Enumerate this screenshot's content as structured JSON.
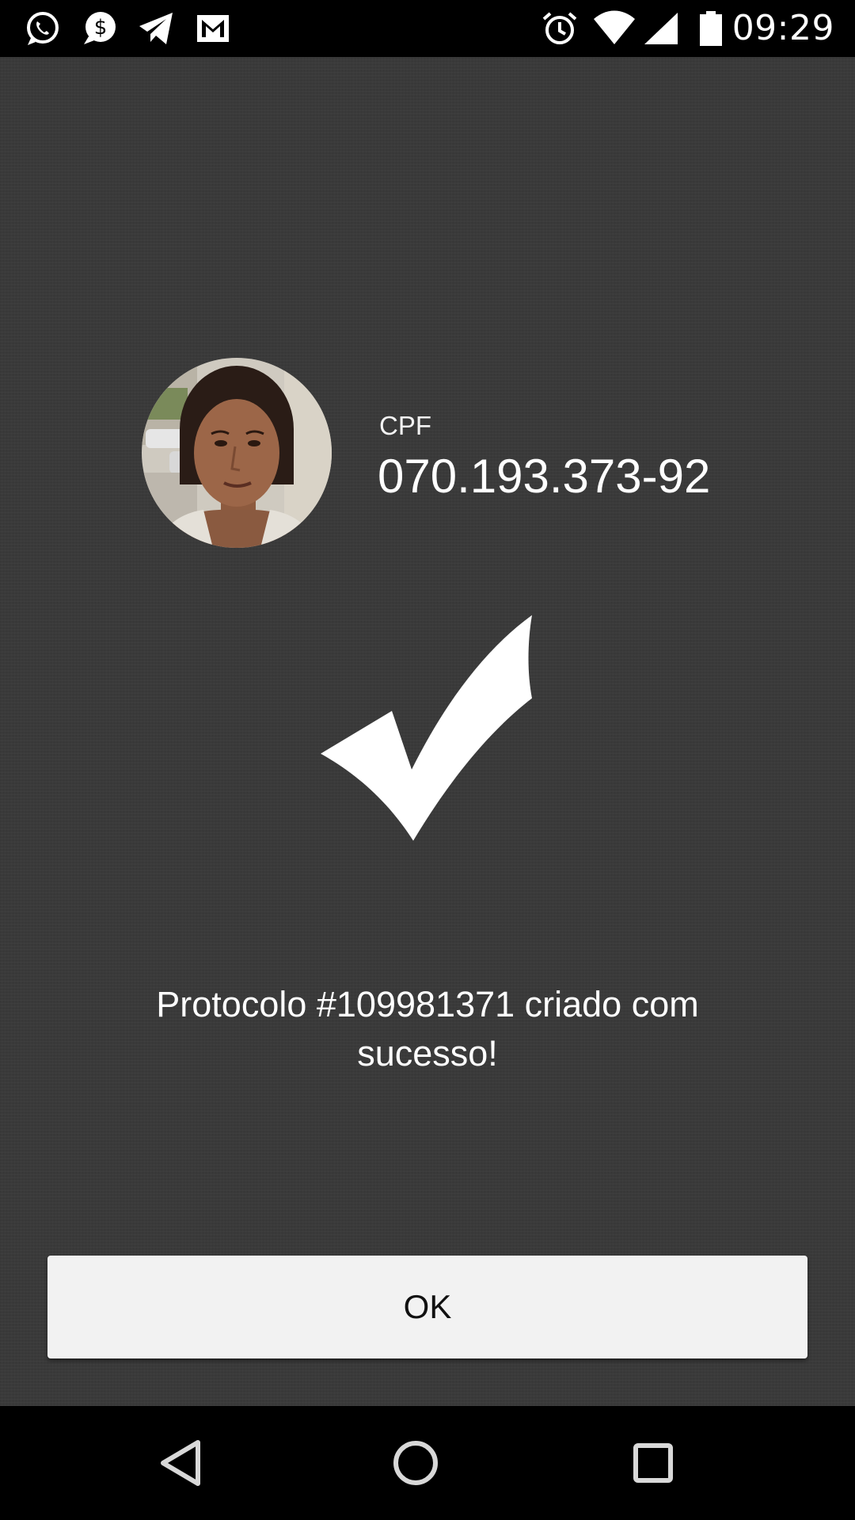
{
  "status_bar": {
    "time": "09:29",
    "notification_icons": [
      "whatsapp-icon",
      "dollar-chat-icon",
      "telegram-icon",
      "gmail-icon"
    ],
    "system_icons": [
      "alarm-icon",
      "wifi-icon",
      "cell-signal-icon",
      "battery-icon"
    ]
  },
  "profile": {
    "avatar": "person-photo",
    "cpf_label": "CPF",
    "cpf_value": "070.193.373-92"
  },
  "result": {
    "icon": "checkmark-icon",
    "message": "Protocolo #109981371 criado com sucesso!"
  },
  "actions": {
    "ok_label": "OK"
  },
  "nav_bar": {
    "buttons": [
      "back-icon",
      "home-icon",
      "recents-icon"
    ]
  },
  "colors": {
    "background": "#3a3a3a",
    "button_bg": "#f2f2f2",
    "text": "#ffffff",
    "bars": "#000000"
  }
}
